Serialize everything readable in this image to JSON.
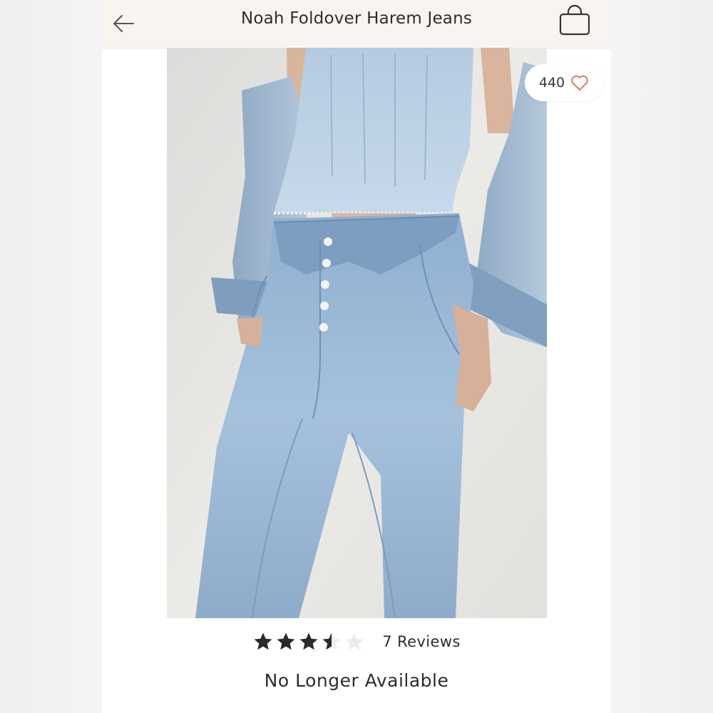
{
  "header": {
    "title": "Noah Foldover Harem Jeans",
    "back_icon": "arrow-left-icon",
    "bag_icon": "shopping-bag-icon"
  },
  "product": {
    "image_alt": "Model wearing light wash jeans with a folded-over waistband, denim corset top and denim jacket",
    "likes": "440",
    "like_icon": "heart-outline-icon",
    "rating": 3.5,
    "rating_max": 5,
    "reviews_label": "7 Reviews",
    "availability": "No Longer Available"
  },
  "colors": {
    "header_bg": "#f8f5f1",
    "heart": "#e07b6b",
    "star_filled": "#2a2a2a",
    "star_empty": "#ececec",
    "denim_light": "#a9c3da",
    "denim_mid": "#7fa3c7"
  }
}
